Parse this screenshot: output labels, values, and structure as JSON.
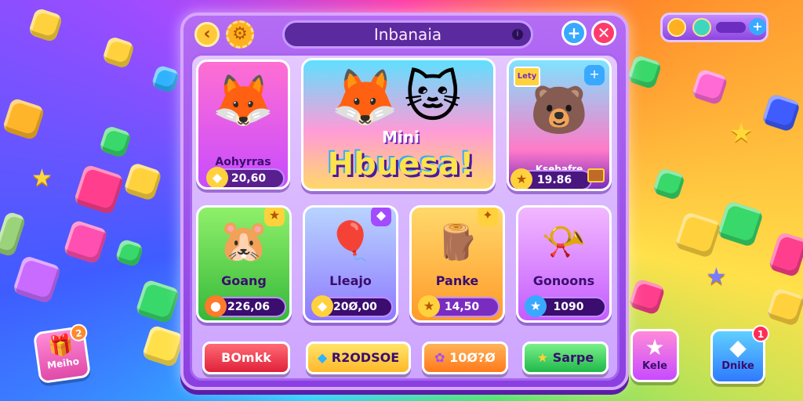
{
  "header": {
    "title": "Inbanaia",
    "back_icon": "chevron-left-icon",
    "gear_icon": "gear-icon",
    "plus_label": "+",
    "close_label": "✕"
  },
  "featured": {
    "left_card": {
      "name": "Aohyrras",
      "price": "20,60"
    },
    "banner": {
      "mini": "Mini",
      "title": "Hbuesa!"
    },
    "right_card": {
      "tag": "Lety",
      "name": "Ksebafre",
      "price": "19.86"
    }
  },
  "items": [
    {
      "name": "Goang",
      "price": "226,06",
      "color": "#6ee04a"
    },
    {
      "name": "Lleajo",
      "price": "20Ø,00",
      "color": "#8fb6ff"
    },
    {
      "name": "Panke",
      "price": "14,50",
      "color": "#ffb02a"
    },
    {
      "name": "Gonoons",
      "price": "1090",
      "color": "#d68cff"
    }
  ],
  "bottom_buttons": [
    {
      "label": "BOmkk",
      "color": "#ff3d4e"
    },
    {
      "label": "R2ODSOE",
      "color": "#ffd23d"
    },
    {
      "label": "10Ø?Ø",
      "color": "#ff8a2a"
    },
    {
      "label": "Sarpe",
      "color": "#3fd66a"
    }
  ],
  "side": {
    "left_tile": {
      "label": "Meiho",
      "badge": "2"
    },
    "right_tiles": [
      {
        "label": "Kele",
        "badge": ""
      },
      {
        "label": "Dnike",
        "badge": "1"
      }
    ]
  },
  "colors": {
    "panel": "#9b55ea",
    "accent": "#ffd23d",
    "primary_text": "#3a0d6e"
  }
}
